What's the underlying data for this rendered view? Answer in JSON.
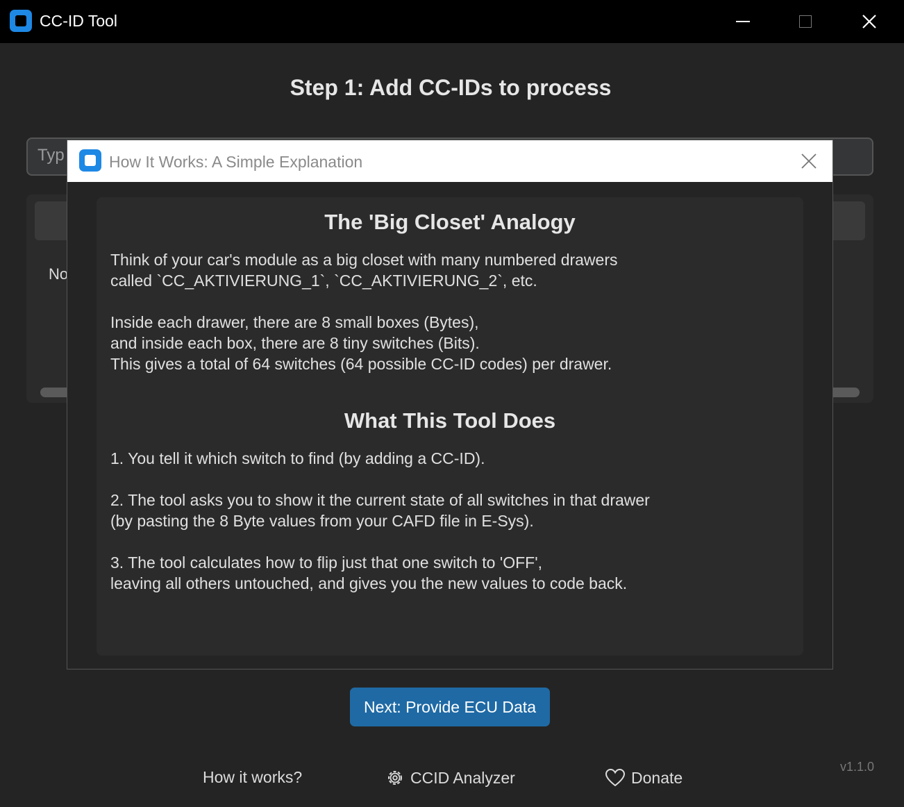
{
  "window": {
    "title": "CC-ID Tool"
  },
  "main": {
    "step_title": "Step 1: Add CC-IDs to process",
    "input_placeholder_visible": "Typ",
    "list_empty_visible": "No",
    "next_button": "Next: Provide ECU Data",
    "version": "v1.1.0"
  },
  "footer": {
    "how_it_works": "How it works?",
    "ccid_analyzer": "CCID Analyzer",
    "donate": "Donate"
  },
  "modal": {
    "title": "How It Works: A Simple Explanation",
    "heading1": "The 'Big Closet' Analogy",
    "para1": "Think of your car's module as a big closet with many numbered drawers\ncalled `CC_AKTIVIERUNG_1`, `CC_AKTIVIERUNG_2`, etc.",
    "para2": "Inside each drawer, there are 8 small boxes (Bytes),\nand inside each box, there are 8 tiny switches (Bits).\nThis gives a total of 64 switches (64 possible CC-ID codes) per drawer.",
    "heading2": "What This Tool Does",
    "step1": "1. You tell it which switch to find (by adding a CC-ID).",
    "step2": "2. The tool asks you to show it the current state of all switches in that drawer\n(by pasting the 8 Byte values from your CAFD file in E-Sys).",
    "step3": "3. The tool calculates how to flip just that one switch to 'OFF',\nleaving all others untouched, and gives you the new values to code back."
  },
  "colors": {
    "accent": "#1f6aa5",
    "icon_blue": "#1e88e5",
    "background": "#242424"
  },
  "icons": {
    "app": "app-icon",
    "gear": "gear-icon",
    "heart": "heart-icon",
    "close": "close-icon"
  }
}
